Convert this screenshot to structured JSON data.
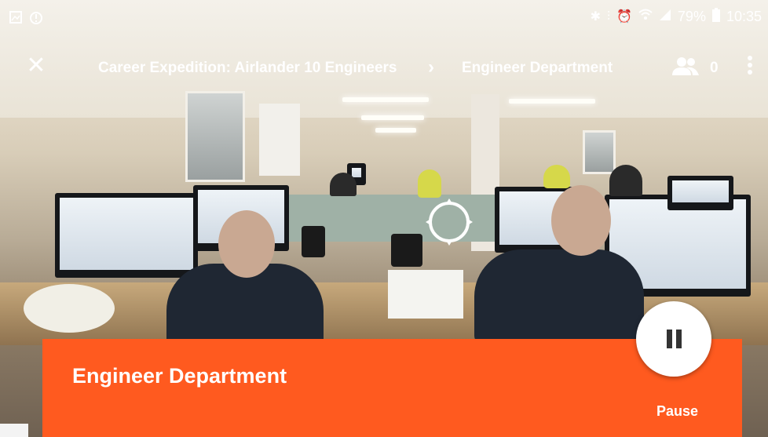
{
  "status_bar": {
    "battery": "79%",
    "time": "10:35",
    "icons": [
      "image-icon",
      "shield-alert-icon",
      "bluetooth-icon",
      "vibrate-icon",
      "alarm-icon",
      "wifi-icon",
      "signal-icon",
      "battery-icon"
    ]
  },
  "app_bar": {
    "close_icon": "close-icon",
    "tour_title": "Career Expedition: Airlander 10 Engineers",
    "separator_icon": "chevron-right-icon",
    "scene_title": "Engineer Department",
    "people_icon": "people-icon",
    "people_count": "0",
    "more_icon": "more-vert-icon"
  },
  "reticle": {
    "icon": "gaze-reticle-icon"
  },
  "info_panel": {
    "title": "Engineer Department",
    "pause_label": "Pause",
    "pause_icon": "pause-icon",
    "accent_color": "#ff5a1f"
  }
}
